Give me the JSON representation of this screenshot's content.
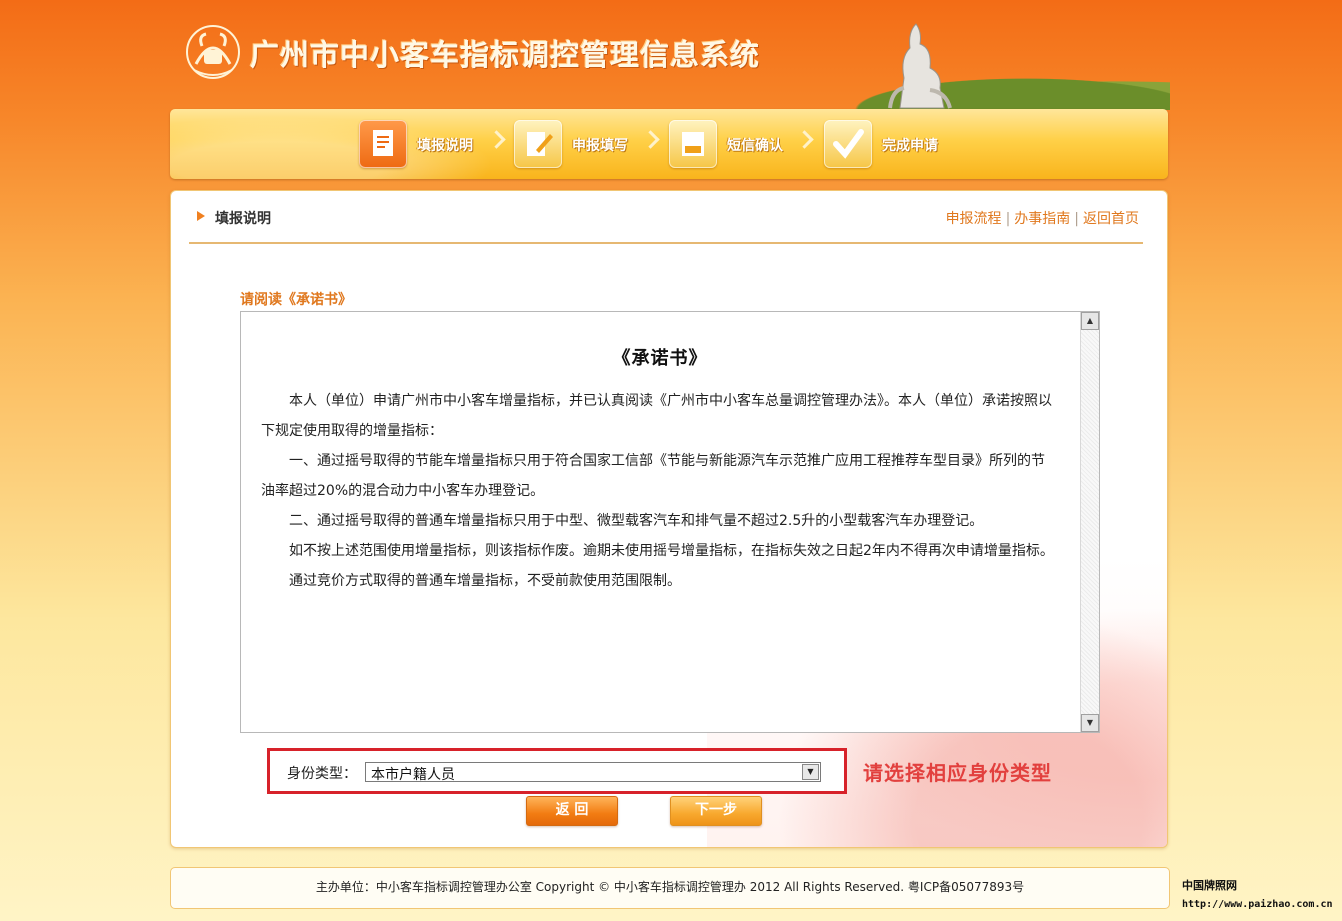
{
  "site": {
    "title": "广州市中小客车指标调控管理信息系统"
  },
  "steps": [
    {
      "label": "填报说明",
      "icon": "form-icon",
      "active": true
    },
    {
      "label": "申报填写",
      "icon": "edit-icon",
      "active": false
    },
    {
      "label": "短信确认",
      "icon": "sms-icon",
      "active": false
    },
    {
      "label": "完成申请",
      "icon": "check-icon",
      "active": false
    }
  ],
  "panel": {
    "title": "填报说明",
    "links": [
      "申报流程",
      "办事指南",
      "返回首页"
    ],
    "read_title": "请阅读《承诺书》"
  },
  "document": {
    "heading": "《承诺书》",
    "paragraphs": [
      "本人（单位）申请广州市中小客车增量指标，并已认真阅读《广州市中小客车总量调控管理办法》。本人（单位）承诺按照以下规定使用取得的增量指标：",
      "一、通过摇号取得的节能车增量指标只用于符合国家工信部《节能与新能源汽车示范推广应用工程推荐车型目录》所列的节油率超过20%的混合动力中小客车办理登记。",
      "二、通过摇号取得的普通车增量指标只用于中型、微型载客汽车和排气量不超过2.5升的小型载客汽车办理登记。",
      "如不按上述范围使用增量指标，则该指标作废。逾期未使用摇号增量指标，在指标失效之日起2年内不得再次申请增量指标。",
      "通过竞价方式取得的普通车增量指标，不受前款使用范围限制。"
    ]
  },
  "identity": {
    "label": "身份类型：",
    "selected": "本市户籍人员",
    "hint": "请选择相应身份类型"
  },
  "buttons": {
    "back": "返 回",
    "next": "下一步"
  },
  "footer": {
    "text": "主办单位：中小客车指标调控管理办公室  Copyright © 中小客车指标调控管理办   2012  All Rights Reserved. 粤ICP备05077893号"
  },
  "watermark": {
    "site": "中国牌照网",
    "url": "http://www.paizhao.com.cn"
  },
  "colors": {
    "accent": "#f08020",
    "highlight": "#d7222a",
    "hint": "#e2403e"
  }
}
